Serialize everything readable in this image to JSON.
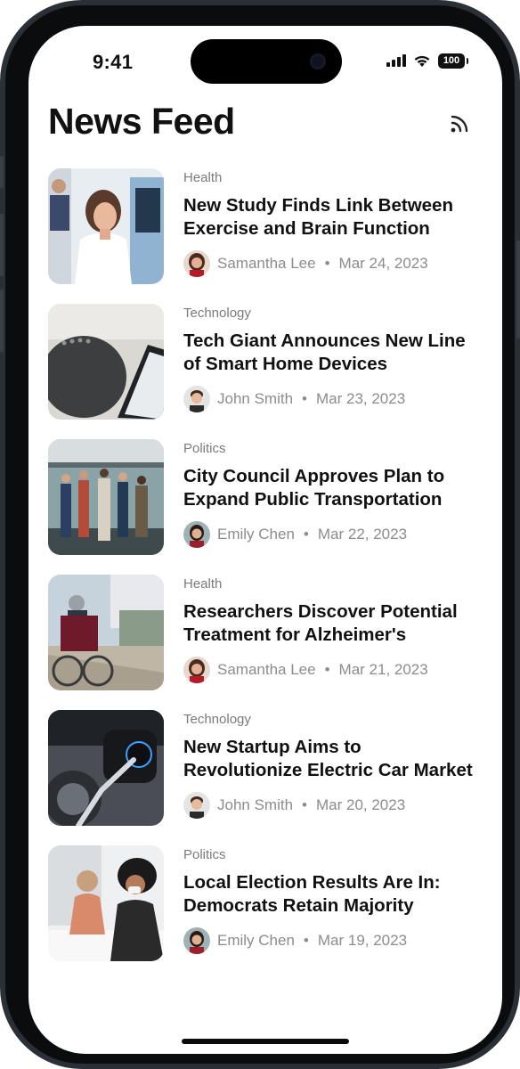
{
  "status_bar": {
    "time": "9:41",
    "battery": "100"
  },
  "header": {
    "title": "News Feed",
    "rss_icon": "rss-icon"
  },
  "articles": [
    {
      "category": "Health",
      "headline": "New Study Finds Link Between Exercise and Brain Function",
      "author": "Samantha Lee",
      "date": "Mar 24, 2023"
    },
    {
      "category": "Technology",
      "headline": "Tech Giant Announces New Line of Smart Home Devices",
      "author": "John Smith",
      "date": "Mar 23, 2023"
    },
    {
      "category": "Politics",
      "headline": "City Council Approves Plan to Expand Public Transportation",
      "author": "Emily Chen",
      "date": "Mar 22, 2023"
    },
    {
      "category": "Health",
      "headline": "Researchers Discover Potential Treatment for Alzheimer's",
      "author": "Samantha Lee",
      "date": "Mar 21, 2023"
    },
    {
      "category": "Technology",
      "headline": "New Startup Aims to Revolutionize Electric Car Market",
      "author": "John Smith",
      "date": "Mar 20, 2023"
    },
    {
      "category": "Politics",
      "headline": "Local Election Results Are In: Democrats Retain Majority",
      "author": "Emily Chen",
      "date": "Mar 19, 2023"
    }
  ],
  "meta_separator": "•",
  "colors": {
    "text_primary": "#111111",
    "text_secondary": "#8c8c8c",
    "background": "#ffffff"
  }
}
